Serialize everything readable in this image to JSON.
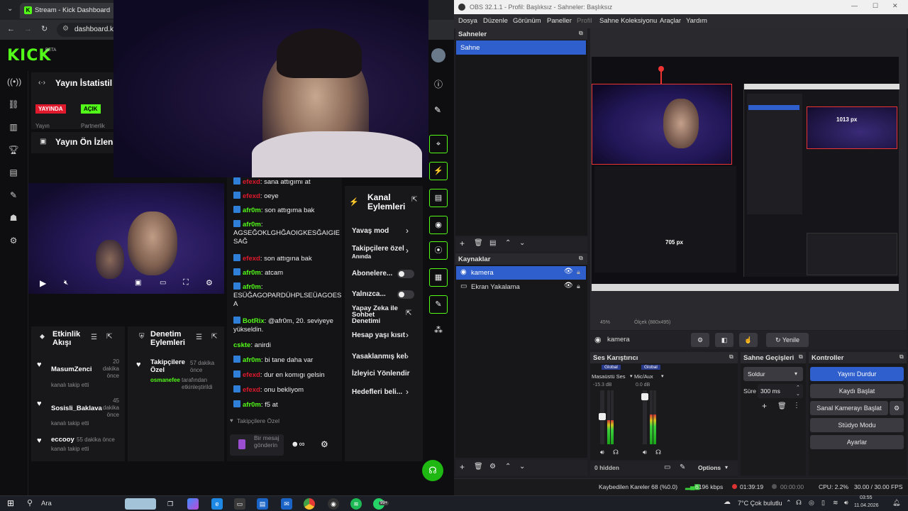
{
  "browser": {
    "tab_title": "Stream - Kick Dashboard",
    "url": "dashboard.ki",
    "logo": "KICK",
    "logo_beta": "BETA"
  },
  "dashboard": {
    "stats_title": "Yayın İstatistil",
    "live_badge": "YAYINDA",
    "status_badge": "AÇIK",
    "stat_label_1": "Yayın",
    "stat_label_2": "Partnerlik",
    "preview_title": "Yayın Ön İzlen",
    "activity_title": "Etkinlik Akışı",
    "moderation_title": "Denetim Eylemleri",
    "activity_feed": [
      {
        "name": "MasumZenci",
        "detail": "kanalı takip etti",
        "time": "20 dakika önce"
      },
      {
        "name": "Sosisli_Baklava",
        "detail": "kanalı takip etti",
        "time": "45 dakika önce"
      },
      {
        "name": "eccooy",
        "detail": "kanalı takip etti",
        "time": "55 dakika önce"
      }
    ],
    "moderation_item": {
      "title": "Takipçilere Özel",
      "time": "57 dakika önce",
      "by": "osmanefee",
      "detail": "tarafından etkinleştirildi"
    }
  },
  "chat": {
    "messages": [
      {
        "user": "efexd",
        "text": "sana attıgımı at"
      },
      {
        "user": "efexd",
        "text": "oeye"
      },
      {
        "user": "afr0m",
        "text": "son attıgıma bak"
      },
      {
        "user": "afr0m",
        "text": "AGSEĞOKLGHĞAOIGKESĞAIGIE SAĞ"
      },
      {
        "user": "efexd",
        "text": "son attıgına bak"
      },
      {
        "user": "afr0m",
        "text": "atcam"
      },
      {
        "user": "afr0m",
        "text": "ESÜĞAGOPARDÜHPLSEÜAGOES A"
      },
      {
        "user": "BotRix",
        "text": "@afr0m, 20. seviyeye yükseldin."
      },
      {
        "user": "cskte",
        "text": "anirdi"
      },
      {
        "user": "afr0m",
        "text": "bi tane daha var"
      },
      {
        "user": "efexd",
        "text": "dur en komıgı gelsin"
      },
      {
        "user": "efexd",
        "text": "onu bekliyom"
      },
      {
        "user": "afr0m",
        "text": "f5 at"
      }
    ],
    "followers_only": "Takipçilere Özel",
    "input_placeholder": "Bir mesaj gönderin"
  },
  "channel_actions": {
    "title": "Kanal Eylemleri",
    "items": [
      "Yavaş mod",
      "Takipçilere özel",
      "Abonelere...",
      "Yalnızca...",
      "Yapay Zeka ile Sohbet Denetimi",
      "Hesap yaşı kısıt",
      "Yasaklanmış kel",
      "İzleyici Yönlendir",
      "Hedefleri beli..."
    ],
    "followers_sub": "Anında"
  },
  "obs": {
    "title": "OBS 32.1.1 - Profil: Başlıksız - Sahneler: Başlıksız",
    "menu": [
      "Dosya",
      "Düzenle",
      "Görünüm",
      "Paneller",
      "Profil",
      "Sahne Koleksiyonu",
      "Araçlar",
      "Yardım"
    ],
    "scenes_title": "Sahneler",
    "scene_selected": "Sahne",
    "sources_title": "Kaynaklar",
    "sources": [
      "kamera",
      "Ekran Yakalama"
    ],
    "preview_px_1": "1013 px",
    "preview_px_2": "705 px",
    "zoom": "45%",
    "scale_info": "Ölçek (880x495)",
    "source_toolbar_name": "kamera",
    "refresh": "Yenile",
    "mixer_title": "Ses Karıştırıcı",
    "mixer_ch1_tag": "Global",
    "mixer_ch2_tag": "Global",
    "mixer_ch1": "Masaüstü Ses",
    "mixer_ch2": "Mic/Aux",
    "mixer_ch1_db": "-15.3 dB",
    "mixer_ch2_db": "0.0 dB",
    "hidden": "0 hidden",
    "options": "Options",
    "transitions_title": "Sahne Geçişleri",
    "transition": "Soldur",
    "duration_label": "Süre",
    "duration": "300 ms",
    "controls_title": "Kontroller",
    "controls": [
      "Yayını Durdur",
      "Kaydı Başlat",
      "Sanal Kamerayı Başlat",
      "Stüdyo Modu",
      "Ayarlar"
    ],
    "status_dropped": "Kaybedilen Kareler 68 (%0.0)",
    "status_kbps": "6196 kbps",
    "status_live": "01:39:19",
    "status_rec": "00:00:00",
    "status_cpu": "CPU: 2.2%",
    "status_fps": "30.00 / 30.00 FPS",
    "meter_ch1": 0.45,
    "meter_ch2": 0.55
  },
  "taskbar": {
    "search": "Ara",
    "weather": "7°C  Çok bulutlu",
    "time": "03:55",
    "date": "11.04.2026",
    "whatsapp_badge": "99+"
  },
  "colors": {
    "kick_green": "#53fc18",
    "obs_blue": "#2f5fcc",
    "live_red": "#e0192c"
  }
}
